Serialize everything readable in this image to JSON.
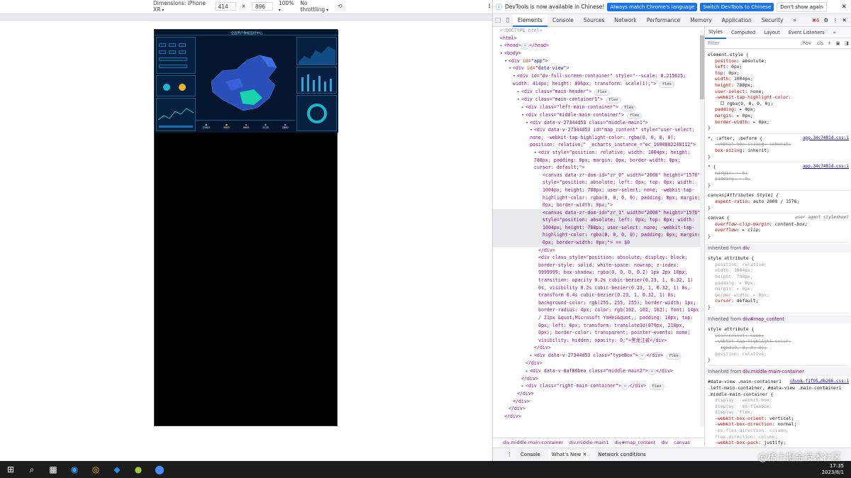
{
  "device_toolbar": {
    "dimensions_label": "Dimensions: iPhone XR",
    "width": "414",
    "times": "×",
    "height": "896",
    "zoom": "100%",
    "throttling": "No throttling"
  },
  "dashboard": {
    "title": "全国用户数据监控中心",
    "bottom_stats": [
      {
        "label": "●",
        "value": "23423"
      },
      {
        "label": "●",
        "value": "5645"
      },
      {
        "label": "●",
        "value": "5645"
      },
      {
        "label": "●",
        "value": "2135"
      },
      {
        "label": "●",
        "value": "1800"
      }
    ]
  },
  "infobar": {
    "message": "DevTools is now available in Chinese!",
    "btn_match": "Always match Chrome's language",
    "btn_switch": "Switch DevTools to Chinese",
    "btn_dont": "Don't show again"
  },
  "tabs": {
    "items": [
      "Elements",
      "Console",
      "Sources",
      "Network",
      "Performance",
      "Memory",
      "Application",
      "Security",
      "»"
    ],
    "badge": "6"
  },
  "elements_lines": {
    "l0": "<!DOCTYPE html>",
    "l1": "<html>",
    "l2": "<head>",
    "l3": "</head>",
    "l4": "<body>",
    "l5_tag": "div",
    "l5_attr": "id",
    "l5_val": "\"app\"",
    "l6_tag": "div",
    "l6_attr": "id",
    "l6_val": "\"data-view\"",
    "l7_text": "<div id=\"dv-full-screen-container\" style=\"--scale: 0.215625; width: 414px; height: 896px; transform: scale(1);\">",
    "l8_text": "<div class=\"main-header\">",
    "l9_text": "<div class=\"main-container1\">",
    "l10_text": "<div class=\"left-main-container\">",
    "l11_text": "<div class=\"middle-main-container\">",
    "l12_text": "<div data-v-27344d53 class=\"middle-main1\">",
    "l13_text": "<div data-v-27344d53 id=\"map_content\" style=\"user-select: none; -webkit-tap-highlight-color: rgba(0, 0, 0, 0); position: relative;\" _echarts_instance_=\"ec_1690882248112\">",
    "l14_text": "<div style=\"position: relative; width: 1004px; height: 788px; padding: 0px; margin: 0px; border-width: 0px; cursor: default;\">",
    "l15_text": "<canvas data-zr-dom-id=\"zr_0\" width=\"2008\" height=\"1576\" style=\"position: absolute; left: 0px; top: 0px; width: 1004px; height: 788px; user-select: none; -webkit-tap-highlight-color: rgba(0, 0, 0, 0); padding: 0px; margin: 0px; border-width: 0px;\">",
    "l16_text": "<canvas data-zr-dom-id=\"zr_1\" width=\"2008\" height=\"1576\" style=\"position: absolute; left: 0px; top: 0px; width: 1004px; height: 788px; user-select: none; -webkit-tap-highlight-color: rgba(0, 0, 0, 0); padding: 0px; margin: 0px; border-width: 0px;\"> == $0",
    "l17_text": "</div>",
    "l18_text": "<div class style=\"position: absolute; display: block; border-style: solid; white-space: nowrap; z-index: 9999999; box-shadow: rgba(0, 0, 0, 0.2) 1px 2px 10px; transition: opacity 0.2s cubic-bezier(0.23, 1, 0.32, 1) 0s, visibility 0.2s cubic-bezier(0.23, 1, 0.32, 1) 0s, transform 0.4s cubic-bezier(0.23, 1, 0.32, 1) 0s; background-color: rgb(255, 255, 255); border-width: 1px; border-radius: 4px; color: rgb(102, 102, 102); font: 14px / 21px &quot;Microsoft YaHei&quot;; padding: 10px; top: 0px; left: 0px; transform: translate3d(879px, 218px, 0px); border-color: transparent; pointer-events: none; visibility: hidden; opacity: 0;\">黑龙江省</div>",
    "l19_text": "</div>",
    "l20_text": "<div data-v-27344d53 class=\"typeBox\">",
    "l21_text": "</div>",
    "l22_text": "<div data-v-0af86bea class=\"middle-main2\">",
    "l23_text": "</div>",
    "l24_text": "<div class=\"right-main-container\">",
    "l25_text": "</div>",
    "l26_text": "</div>",
    "l27_text": "</div>",
    "l28_text": "</div>",
    "pill_flex": "flex",
    "pill_dots": "⋯"
  },
  "breadcrumbs": [
    "div.middle-main-container",
    "div.middle-main1",
    "div#map_content",
    "div",
    "canvas"
  ],
  "drawer": {
    "console": "Console",
    "whatsnew": "What's New",
    "netcond": "Network conditions"
  },
  "styles_tabs": [
    "Styles",
    "Computed",
    "Layout",
    "Event Listeners",
    "»"
  ],
  "styles_filter": {
    "placeholder": "Filter",
    "hov": ":hov",
    "cls": ".cls",
    "plus": "+"
  },
  "styles": {
    "element_style": "element.style {",
    "es_props": [
      [
        "position",
        "absolute;"
      ],
      [
        "left",
        "0px;"
      ],
      [
        "top",
        "0px;"
      ],
      [
        "width",
        "1004px;"
      ],
      [
        "height",
        "788px;"
      ],
      [
        "user-select",
        "none;"
      ],
      [
        "-webkit-tap-highlight-color",
        ""
      ],
      [
        "",
        "rgba(0, 0, 0, 0);"
      ],
      [
        "padding",
        "▸ 0px;"
      ],
      [
        "margin",
        "▸ 0px;"
      ],
      [
        "border-width",
        "▸ 0px;"
      ]
    ],
    "r2_sel": "*, :after, :before {",
    "r2_src": "app.34c7481d.css:1",
    "r2_p1n": "-webkit-box-sizing",
    "r2_p1v": "inherit;",
    "r2_p2n": "box-sizing",
    "r2_p2v": "inherit;",
    "r3_sel": "* {",
    "r3_src": "app.34c7481d.css:1",
    "r3_p1n": "margin",
    "r3_p1v": "▸ 0;",
    "r3_p2n": "padding",
    "r3_p2v": "▸ 0;",
    "r4_sel": "canvas[Attributes Style] {",
    "r4_p1n": "aspect-ratio",
    "r4_p1v": "auto 2008 / 1576;",
    "r5_sel": "canvas {",
    "r5_src": "user agent stylesheet",
    "r5_p1n": "overflow-clip-margin",
    "r5_p1v": "content-box;",
    "r5_p2n": "overflow",
    "r5_p2v": "▸ clip;",
    "inh1_label": "Inherited from",
    "inh1_el": "div",
    "r6_sel": "style attribute {",
    "r6_props": [
      [
        "position",
        "relative;"
      ],
      [
        "width",
        "1004px;"
      ],
      [
        "height",
        "788px;"
      ],
      [
        "padding",
        "▸ 0px;"
      ],
      [
        "margin",
        "▸ 0px;"
      ],
      [
        "border-width",
        "▸ 0px;"
      ],
      [
        "cursor",
        "default;"
      ]
    ],
    "inh2_label": "Inherited from",
    "inh2_el": "div#map_content",
    "r7_sel": "style attribute {",
    "r7_props": [
      [
        "user-select",
        "none;"
      ],
      [
        "-webkit-tap-highlight-color",
        ""
      ],
      [
        "",
        "rgba(0, 0, 0, 0);"
      ],
      [
        "position",
        "relative;"
      ]
    ],
    "inh3_label": "Inherited from",
    "inh3_el": "div.middle-main-container",
    "r8_sel": "#data-view .main-container1 .left-main-container, #data-view .main-container1 .middle-main-container {",
    "r8_src": "chunk-f1f95…0b266.css:1",
    "r8_props": [
      [
        "display",
        "-webkit-box;"
      ],
      [
        "display",
        "-ms-flexbox;"
      ],
      [
        "display",
        "flex;"
      ],
      [
        "-webkit-box-orient",
        "vertical;"
      ],
      [
        "-webkit-box-direction",
        "normal;"
      ],
      [
        "-ms-flex-direction",
        "column;"
      ],
      [
        "flex-direction",
        "column;"
      ],
      [
        "-webkit-box-pack",
        "justify;"
      ]
    ]
  },
  "taskbar": {
    "time": "17:35",
    "date": "2023/8/1"
  },
  "watermark": "@稀土掘金技术社区",
  "colors": {
    "accent": "#1a73e8",
    "dashboard_bg": "#04162e",
    "map_blue": "#3a5fd6"
  }
}
